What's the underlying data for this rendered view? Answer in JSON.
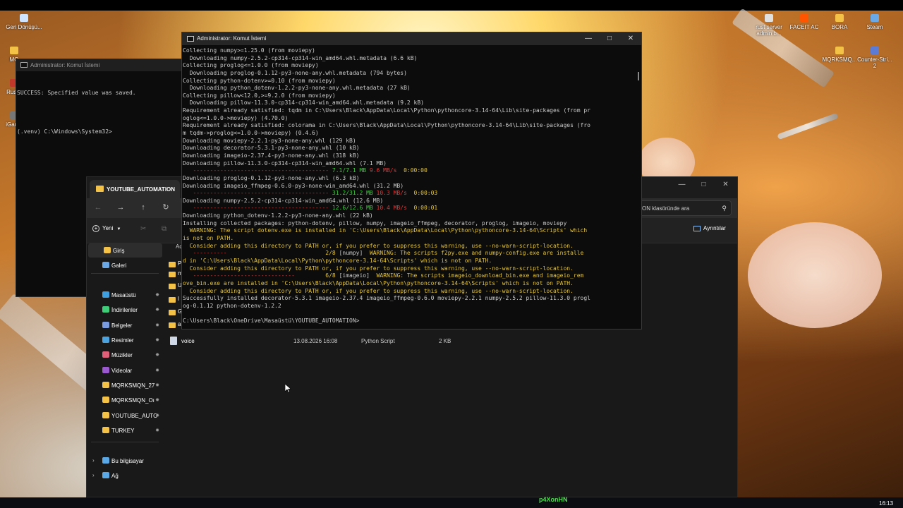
{
  "desktop": {
    "icons": [
      {
        "label": "Geri Dönüşü...",
        "color": "#cfe4ff"
      },
      {
        "label": "rust server admin b...",
        "color": "#e0e0e0"
      },
      {
        "label": "FACEIT AC",
        "color": "#ff5500"
      },
      {
        "label": "BORA",
        "color": "#f3c247"
      },
      {
        "label": "Steam",
        "color": "#6aa9e6"
      },
      {
        "label": "MQRKSMQ...",
        "color": "#f3c247"
      },
      {
        "label": "Counter-Stri... 2",
        "color": "#5b7bd5"
      },
      {
        "label": "MQ",
        "color": "#f3c247"
      },
      {
        "label": "RustA",
        "color": "#c0392b"
      },
      {
        "label": "iGame",
        "color": "#777"
      }
    ]
  },
  "cmd_small": {
    "title": "Administrator: Komut İstemi",
    "lines": [
      "SUCCESS: Specified value was saved.",
      "",
      "(.venv) C:\\Windows\\System32>"
    ]
  },
  "explorer": {
    "tab_title": "YOUTUBE_AUTOMATION",
    "search_placeholder": "ON klasöründe ara",
    "new_label": "Yeni",
    "details_label": "Ayrıntılar",
    "column_header_partial": "Ad",
    "sidebar": [
      {
        "label": "Giriş",
        "icon": "home-icon",
        "color": "#f3c247",
        "pinned": false,
        "active": true
      },
      {
        "label": "Galeri",
        "icon": "gallery-icon",
        "color": "#6aa9e6",
        "pinned": false
      },
      {
        "label": "Masaüstü",
        "icon": "desktop-icon",
        "color": "#3ea0e0",
        "pinned": true
      },
      {
        "label": "İndirilenler",
        "icon": "download-icon",
        "color": "#3fcd7a",
        "pinned": true
      },
      {
        "label": "Belgeler",
        "icon": "documents-icon",
        "color": "#7a9be0",
        "pinned": true
      },
      {
        "label": "Resimler",
        "icon": "pictures-icon",
        "color": "#4aa3df",
        "pinned": true
      },
      {
        "label": "Müzikler",
        "icon": "music-icon",
        "color": "#e0607a",
        "pinned": true
      },
      {
        "label": "Videolar",
        "icon": "videos-icon",
        "color": "#9b59d0",
        "pinned": true
      },
      {
        "label": "MQRKSMQN_27",
        "icon": "folder-icon",
        "color": "#f3c247",
        "pinned": true
      },
      {
        "label": "MQRKSMQN_Oı",
        "icon": "folder-icon",
        "color": "#f3c247",
        "pinned": true
      },
      {
        "label": "YOUTUBE_AUTC",
        "icon": "folder-icon",
        "color": "#f3c247",
        "pinned": true
      },
      {
        "label": "TURKEY",
        "icon": "folder-icon",
        "color": "#f3c247",
        "pinned": true
      },
      {
        "label": "Bu bilgisayar",
        "icon": "computer-icon",
        "color": "#5aa9e6",
        "expandable": true
      },
      {
        "label": "Ağ",
        "icon": "network-icon",
        "color": "#5aa9e6",
        "expandable": true
      }
    ],
    "partial_rows": [
      "Pd",
      "m",
      "U",
      "l",
      "G",
      "a"
    ],
    "file_row": {
      "name": "voice",
      "date": "13.08.2026 16:08",
      "type": "Python Script",
      "size": "2 KB"
    }
  },
  "cmd_main": {
    "title": "Administrator: Komut İstemi",
    "lines": [
      [
        {
          "t": "Collecting numpy>=1.25.0 (from moviepy)",
          "c": "gray"
        }
      ],
      [
        {
          "t": "  Downloading numpy-2.5.2-cp314-cp314-win_amd64.whl.metadata (6.6 kB)",
          "c": "gray"
        }
      ],
      [
        {
          "t": "Collecting proglog<=1.0.0 (from moviepy)",
          "c": "gray"
        }
      ],
      [
        {
          "t": "  Downloading proglog-0.1.12-py3-none-any.whl.metadata (794 bytes)",
          "c": "gray"
        }
      ],
      [
        {
          "t": "Collecting python-dotenv>=0.10 (from moviepy)",
          "c": "gray"
        }
      ],
      [
        {
          "t": "  Downloading python_dotenv-1.2.2-py3-none-any.whl.metadata (27 kB)",
          "c": "gray"
        }
      ],
      [
        {
          "t": "Collecting pillow<12.0,>=9.2.0 (from moviepy)",
          "c": "gray"
        }
      ],
      [
        {
          "t": "  Downloading pillow-11.3.0-cp314-cp314-win_amd64.whl.metadata (9.2 kB)",
          "c": "gray"
        }
      ],
      [
        {
          "t": "Requirement already satisfied: tqdm in C:\\Users\\Black\\AppData\\Local\\Python\\pythoncore-3.14-64\\Lib\\site-packages (from pr",
          "c": "gray"
        }
      ],
      [
        {
          "t": "oglog<=1.0.0->moviepy) (4.70.0)",
          "c": "gray"
        }
      ],
      [
        {
          "t": "Requirement already satisfied: colorama in C:\\Users\\Black\\AppData\\Local\\Python\\pythoncore-3.14-64\\Lib\\site-packages (fro",
          "c": "gray"
        }
      ],
      [
        {
          "t": "m tqdm->proglog<=1.0.0->moviepy) (0.4.6)",
          "c": "gray"
        }
      ],
      [
        {
          "t": "Downloading moviepy-2.2.1-py3-none-any.whl (129 kB)",
          "c": "gray"
        }
      ],
      [
        {
          "t": "Downloading decorator-5.3.1-py3-none-any.whl (10 kB)",
          "c": "gray"
        }
      ],
      [
        {
          "t": "Downloading imageio-2.37.4-py3-none-any.whl (318 kB)",
          "c": "gray"
        }
      ],
      [
        {
          "t": "Downloading pillow-11.3.0-cp314-cp314-win_amd64.whl (7.1 MB)",
          "c": "gray"
        }
      ],
      [
        {
          "t": "   ---------------------------------------- ",
          "c": "red"
        },
        {
          "t": "7.1/7.1 MB",
          "c": "grn"
        },
        {
          "t": " 9.6 MB/s",
          "c": "red"
        },
        {
          "t": "  0:00:00",
          "c": "yel"
        }
      ],
      [
        {
          "t": "Downloading proglog-0.1.12-py3-none-any.whl (6.3 kB)",
          "c": "gray"
        }
      ],
      [
        {
          "t": "Downloading imageio_ffmpeg-0.6.0-py3-none-win_amd64.whl (31.2 MB)",
          "c": "gray"
        }
      ],
      [
        {
          "t": "   ---------------------------------------- ",
          "c": "red"
        },
        {
          "t": "31.2/31.2 MB",
          "c": "grn"
        },
        {
          "t": " 10.3 MB/s",
          "c": "red"
        },
        {
          "t": "  0:00:03",
          "c": "yel"
        }
      ],
      [
        {
          "t": "Downloading numpy-2.5.2-cp314-cp314-win_amd64.whl (12.6 MB)",
          "c": "gray"
        }
      ],
      [
        {
          "t": "   ---------------------------------------- ",
          "c": "red"
        },
        {
          "t": "12.6/12.6 MB",
          "c": "grn"
        },
        {
          "t": " 10.4 MB/s",
          "c": "red"
        },
        {
          "t": "  0:00:01",
          "c": "yel"
        }
      ],
      [
        {
          "t": "Downloading python_dotenv-1.2.2-py3-none-any.whl (22 kB)",
          "c": "gray"
        }
      ],
      [
        {
          "t": "Installing collected packages: python-dotenv, pillow, numpy, imageio_ffmpeg, decorator, proglog, imageio, moviepy",
          "c": "gray"
        }
      ],
      [
        {
          "t": "  WARNING: The script dotenv.exe is installed in 'C:\\Users\\Black\\AppData\\Local\\Python\\pythoncore-3.14-64\\Scripts' which",
          "c": "yel"
        }
      ],
      [
        {
          "t": "is not on PATH.",
          "c": "yel"
        }
      ],
      [
        {
          "t": "  Consider adding this directory to PATH or, if you prefer to suppress this warning, use --no-warn-script-location.",
          "c": "yel"
        }
      ],
      [
        {
          "t": "   ----------                             ",
          "c": "red"
        },
        {
          "t": "2/8 ",
          "c": "yel"
        },
        {
          "t": "[numpy]",
          "c": "gray"
        },
        {
          "t": "  WARNING: The scripts f2py.exe and numpy-config.exe are installe",
          "c": "yel"
        }
      ],
      [
        {
          "t": "d in 'C:\\Users\\Black\\AppData\\Local\\Python\\pythoncore-3.14-64\\Scripts' which is not on PATH.",
          "c": "yel"
        }
      ],
      [
        {
          "t": "  Consider adding this directory to PATH or, if you prefer to suppress this warning, use --no-warn-script-location.",
          "c": "yel"
        }
      ],
      [
        {
          "t": "   ------------------------------         ",
          "c": "red"
        },
        {
          "t": "6/8 ",
          "c": "yel"
        },
        {
          "t": "[imageio]",
          "c": "gray"
        },
        {
          "t": "  WARNING: The scripts imageio_download_bin.exe and imageio_rem",
          "c": "yel"
        }
      ],
      [
        {
          "t": "ove_bin.exe are installed in 'C:\\Users\\Black\\AppData\\Local\\Python\\pythoncore-3.14-64\\Scripts' which is not on PATH.",
          "c": "yel"
        }
      ],
      [
        {
          "t": "  Consider adding this directory to PATH or, if you prefer to suppress this warning, use --no-warn-script-location.",
          "c": "yel"
        }
      ],
      [
        {
          "t": "Successfully installed decorator-5.3.1 imageio-2.37.4 imageio_ffmpeg-0.6.0 moviepy-2.2.1 numpy-2.5.2 pillow-11.3.0 progl",
          "c": "gray"
        }
      ],
      [
        {
          "t": "og-0.1.12 python-dotenv-1.2.2",
          "c": "gray"
        }
      ],
      [
        {
          "t": "",
          "c": "gray"
        }
      ],
      [
        {
          "t": "C:\\Users\\Black\\OneDrive\\Masaüstü\\YOUTUBE_AUTOMATION>",
          "c": "gray"
        }
      ]
    ]
  },
  "overlay": {
    "watermark": "p4XonHN",
    "clock": "16:13"
  }
}
